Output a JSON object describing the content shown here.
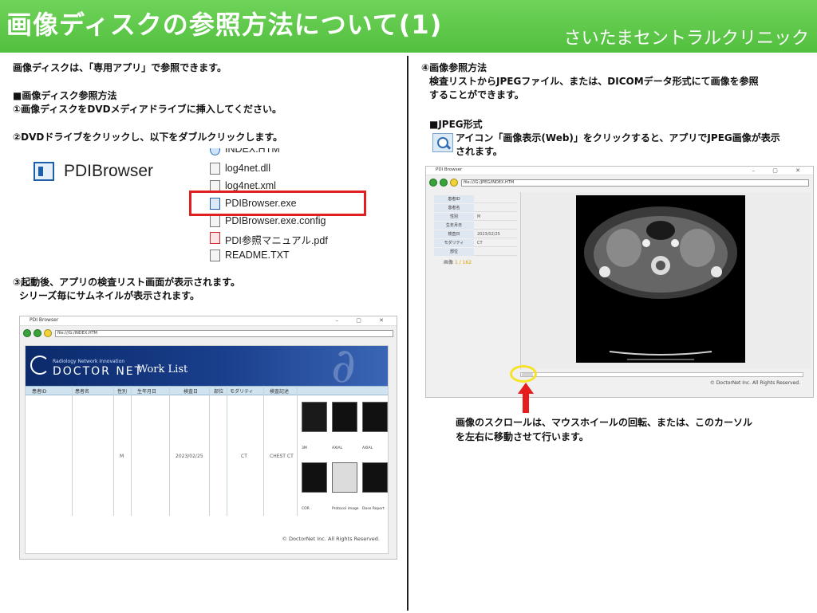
{
  "header": {
    "title": "画像ディスクの参照方法について(1)",
    "clinic": "さいたまセントラルクリニック",
    "colors": {
      "green": "#5cc84a",
      "text": "#ffffff"
    }
  },
  "left": {
    "intro": "画像ディスクは、「専用アプリ」で参照できます。",
    "section_title": "■画像ディスク参照方法",
    "step1": "①画像ディスクをDVDメディアドライブに挿入してください。",
    "step2": "②DVDドライブをクリックし、以下をダブルクリックします。",
    "app_icon_label": "PDIBrowser",
    "files": [
      "INDEX.HTM",
      "log4net.dll",
      "log4net.xml",
      "PDIBrowser.exe",
      "PDIBrowser.exe.config",
      "PDI参照マニュアル.pdf",
      "README.TXT"
    ],
    "highlight_color": "#e02020",
    "step3_line1": "③起動後、アプリの検査リスト画面が表示されます。",
    "step3_line2": "シリーズ毎にサムネイルが表示されます。"
  },
  "worklist": {
    "window_title": "PDI Browser",
    "address": "file:///G:/INDEX.HTM",
    "banner_small": "Radiology Network Innovation",
    "banner_logo": "DOCTOR NET",
    "banner_title": "Work List",
    "columns": [
      "患者ID",
      "患者名",
      "性別",
      "生年月日",
      "検査日",
      "部位",
      "モダリティ",
      "検査記述"
    ],
    "row": {
      "sex": "M",
      "date": "2023/02/25",
      "modality": "CT",
      "description": "CHEST CT"
    },
    "thumb_captions": [
      "3M",
      "AXIAL",
      "AXIAL",
      "COR",
      "Protocol image",
      "Dose Report"
    ],
    "footer": "© DoctorNet Inc. All Rights Reserved."
  },
  "right": {
    "step4_title": "④画像参照方法",
    "step4_line1": "検査リストからJPEGファイル、または、DICOMデータ形式にて画像を参照",
    "step4_line2": "することができます。",
    "jpeg_title": "■JPEG形式",
    "jpeg_line1": "アイコン「画像表示(Web)」をクリックすると、アプリでJPEG画像が表示",
    "jpeg_line2": "されます。",
    "scroll_line1": "画像のスクロールは、マウスホイールの回転、または、このカーソル",
    "scroll_line2": "を左右に移動させて行います。"
  },
  "viewer": {
    "window_title": "PDI Browser",
    "address": "file:///G:/JPEG/INDEX.HTM",
    "info_rows": [
      {
        "key": "患者ID",
        "value": ""
      },
      {
        "key": "患者名",
        "value": ""
      },
      {
        "key": "性別",
        "value": "M"
      },
      {
        "key": "生年月日",
        "value": ""
      },
      {
        "key": "検査日",
        "value": "2023/02/25"
      },
      {
        "key": "モダリティ",
        "value": "CT"
      },
      {
        "key": "部位",
        "value": ""
      }
    ],
    "image_label": "画像",
    "image_count": "1 / 162",
    "footer": "© DoctorNet Inc. All Rights Reserved.",
    "ring_color": "#f4e32a",
    "arrow_color": "#e51d1d"
  }
}
